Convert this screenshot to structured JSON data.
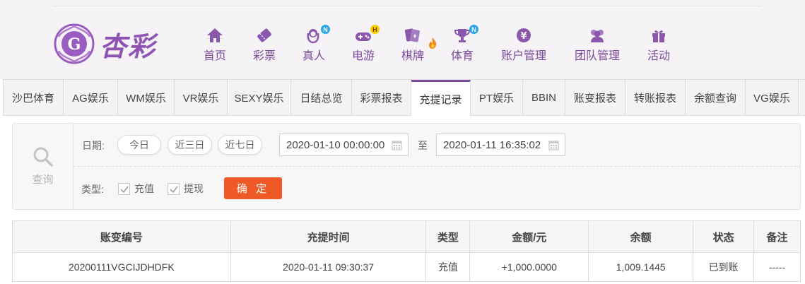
{
  "brand": {
    "name": "杏彩"
  },
  "nav": [
    {
      "label": "首页",
      "icon": "home-icon",
      "badge": ""
    },
    {
      "label": "彩票",
      "icon": "lottery-ticket-icon",
      "badge": ""
    },
    {
      "label": "真人",
      "icon": "live-dealer-icon",
      "badge": "N"
    },
    {
      "label": "电游",
      "icon": "gamepad-icon",
      "badge": "H"
    },
    {
      "label": "棋牌",
      "icon": "cards-icon",
      "badge": ""
    },
    {
      "label": "体育",
      "icon": "trophy-icon",
      "badge": "N"
    },
    {
      "label": "账户管理",
      "icon": "yen-coin-icon",
      "badge": ""
    },
    {
      "label": "团队管理",
      "icon": "team-icon",
      "badge": ""
    },
    {
      "label": "活动",
      "icon": "gift-icon",
      "badge": ""
    }
  ],
  "tabs": [
    {
      "label": "沙巴体育",
      "active": false
    },
    {
      "label": "AG娱乐",
      "active": false
    },
    {
      "label": "WM娱乐",
      "active": false
    },
    {
      "label": "VR娱乐",
      "active": false
    },
    {
      "label": "SEXY娱乐",
      "active": false
    },
    {
      "label": "日结总览",
      "active": false
    },
    {
      "label": "彩票报表",
      "active": false
    },
    {
      "label": "充提记录",
      "active": true
    },
    {
      "label": "PT娱乐",
      "active": false
    },
    {
      "label": "BBIN",
      "active": false
    },
    {
      "label": "账变报表",
      "active": false
    },
    {
      "label": "转账报表",
      "active": false
    },
    {
      "label": "余额查询",
      "active": false
    },
    {
      "label": "VG娱乐",
      "active": false
    }
  ],
  "filter": {
    "query_label": "查询",
    "date_label": "日期:",
    "quick_ranges": [
      "今日",
      "近三日",
      "近七日"
    ],
    "start_date": "2020-01-10 00:00:00",
    "to_label": "至",
    "end_date": "2020-01-11 16:35:02",
    "type_label": "类型:",
    "types": [
      {
        "label": "充值",
        "checked": true
      },
      {
        "label": "提现",
        "checked": true
      }
    ],
    "confirm_label": "确 定"
  },
  "table": {
    "columns": [
      "账变编号",
      "充提时间",
      "类型",
      "金额/元",
      "余额",
      "状态",
      "备注"
    ],
    "rows": [
      [
        "20200111VGCIJDHDFK",
        "2020-01-11 09:30:37",
        "充值",
        "+1,000.0000",
        "1,009.1445",
        "已到账",
        "-----"
      ]
    ]
  },
  "colors": {
    "accent": "#7c4f9f",
    "confirm": "#ee5a26",
    "amount_positive": "#d2261c",
    "status_ok": "#2e9e2e"
  }
}
